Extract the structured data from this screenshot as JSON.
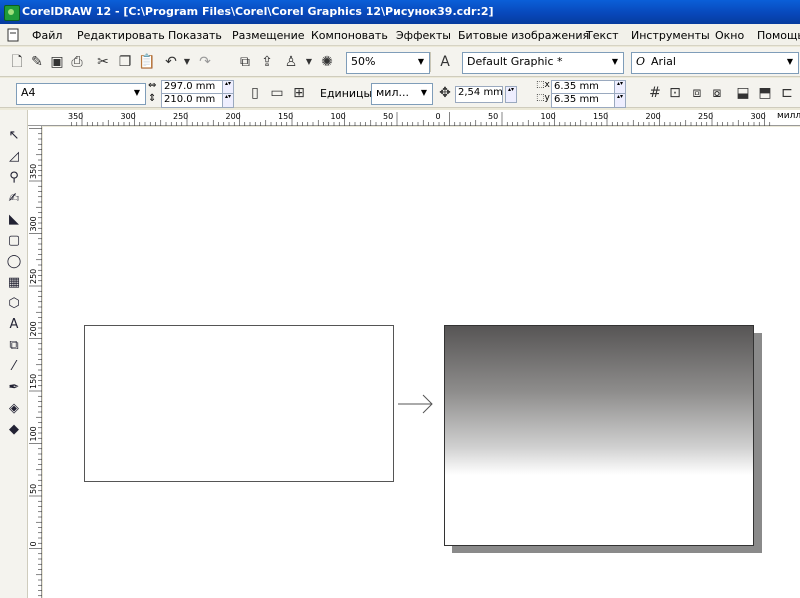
{
  "window": {
    "title": "CorelDRAW 12 - [C:\\Program Files\\Corel\\Corel Graphics 12\\Рисунок39.cdr:2]"
  },
  "menu": {
    "items": [
      {
        "label": "Файл"
      },
      {
        "label": "Редактировать"
      },
      {
        "label": "Показать"
      },
      {
        "label": "Размещение"
      },
      {
        "label": "Компоновать"
      },
      {
        "label": "Эффекты"
      },
      {
        "label": "Битовые изображения"
      },
      {
        "label": "Текст"
      },
      {
        "label": "Инструменты"
      },
      {
        "label": "Окно"
      },
      {
        "label": "Помощь"
      }
    ]
  },
  "standard_toolbar": {
    "zoom_value": "50%",
    "style_value": "Default Graphic *",
    "font_value": "Arial",
    "font_icon": "font-o-icon"
  },
  "property_bar": {
    "paper_value": "A4",
    "width_value": "297.0 mm",
    "height_value": "210.0 mm",
    "units_label": "Единицы:",
    "units_value": "мил...",
    "nudge_value": "2,54 mm",
    "dup_x_value": "6.35 mm",
    "dup_y_value": "6.35 mm"
  },
  "ruler": {
    "h_labels": [
      "350",
      "300",
      "250",
      "200",
      "150",
      "100",
      "50",
      "0",
      "50",
      "100",
      "150",
      "200",
      "250",
      "300"
    ],
    "h_unit": "милл",
    "v_labels": [
      "350",
      "300",
      "250",
      "200",
      "150",
      "100",
      "50",
      "0"
    ]
  },
  "colors": {
    "title_bar": "#0846b8",
    "gradient_dark": "#575555",
    "gradient_light": "#ffffff"
  }
}
